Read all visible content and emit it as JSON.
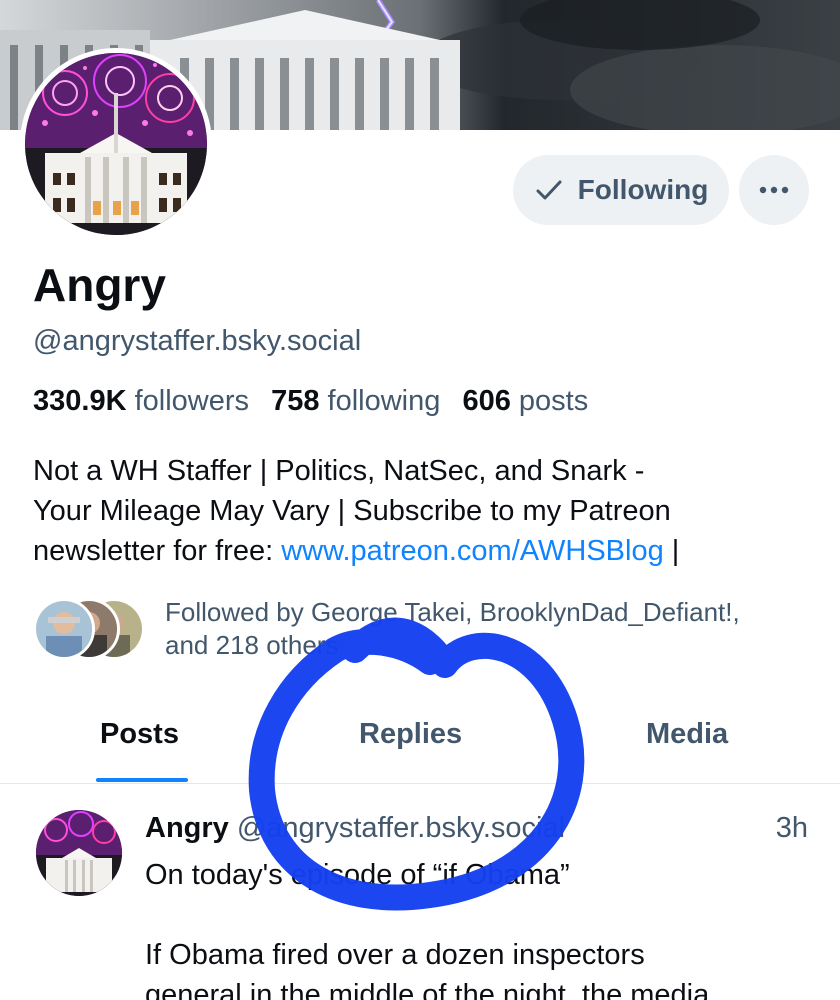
{
  "profile": {
    "display_name": "Angry",
    "handle": "@angrystaffer.bsky.social",
    "follow_button_label": "Following",
    "more_button_icon": "ellipsis-icon",
    "stats": {
      "followers_count": "330.9K",
      "followers_label": "followers",
      "following_count": "758",
      "following_label": "following",
      "posts_count": "606",
      "posts_label": "posts"
    },
    "bio_line1": "Not a WH Staffer | Politics, NatSec, and Snark -",
    "bio_line2": "Your Mileage May Vary | Subscribe to my Patreon",
    "bio_line3_prefix": "newsletter for free: ",
    "bio_link": "www.patreon.com/AWHSBlog",
    "bio_line3_suffix": " |",
    "followed_by_line1": "Followed by George Takei, BrooklynDad_Defiant!,",
    "followed_by_line2": "and 218 others"
  },
  "tabs": [
    {
      "label": "Posts",
      "active": true
    },
    {
      "label": "Replies",
      "active": false
    },
    {
      "label": "Media",
      "active": false
    }
  ],
  "post": {
    "author": "Angry",
    "handle": "@angrystaffer.bsky.social",
    "time": "3h",
    "text": "On today's episode of “if Obama”\n\nIf Obama fired over a dozen inspectors\ngeneral in the middle of the night, the media"
  },
  "colors": {
    "accent": "#1083fe",
    "muted_text": "#42576c",
    "button_bg": "#eef1f4",
    "annotation_stroke": "#1440f0"
  }
}
